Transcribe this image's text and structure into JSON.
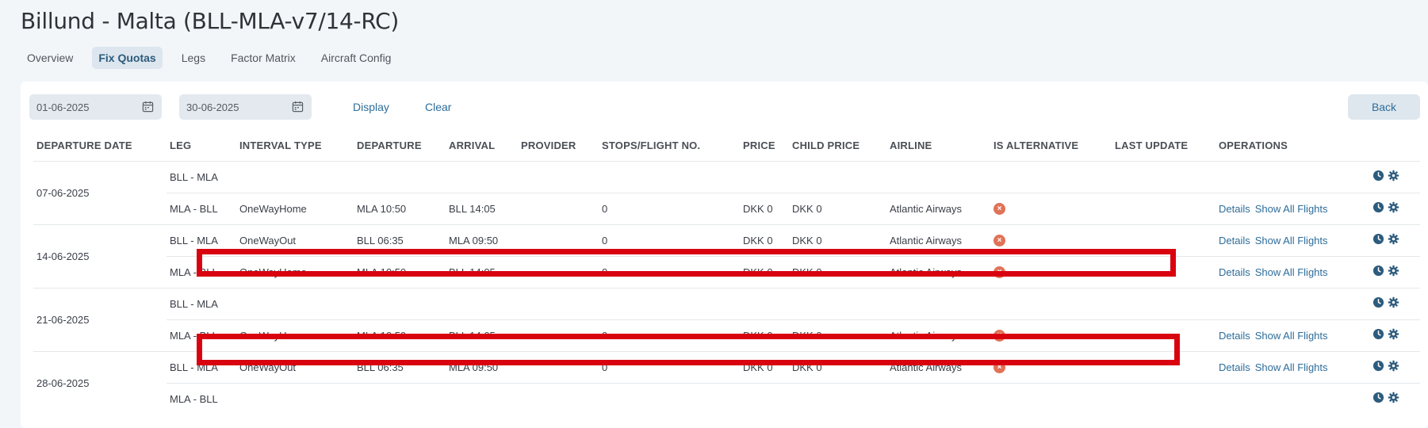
{
  "page": {
    "title": "Billund - Malta (BLL-MLA-v7/14-RC)"
  },
  "tabs": [
    {
      "label": "Overview",
      "active": false
    },
    {
      "label": "Fix Quotas",
      "active": true
    },
    {
      "label": "Legs",
      "active": false
    },
    {
      "label": "Factor Matrix",
      "active": false
    },
    {
      "label": "Aircraft Config",
      "active": false
    }
  ],
  "filters": {
    "date_from": "01-06-2025",
    "date_to": "30-06-2025",
    "display_label": "Display",
    "clear_label": "Clear",
    "back_label": "Back"
  },
  "table": {
    "columns": [
      "DEPARTURE DATE",
      "LEG",
      "INTERVAL TYPE",
      "DEPARTURE",
      "ARRIVAL",
      "PROVIDER",
      "STOPS/FLIGHT NO.",
      "PRICE",
      "CHILD PRICE",
      "AIRLINE",
      "IS ALTERNATIVE",
      "LAST UPDATE",
      "OPERATIONS"
    ],
    "groups": [
      {
        "date": "07-06-2025",
        "rows": [
          {
            "leg": "BLL - MLA",
            "interval": "",
            "departure": "",
            "arrival": "",
            "provider": "",
            "stops": "",
            "price": "",
            "child_price": "",
            "airline": "",
            "is_alternative": false,
            "last_update": "",
            "details": "",
            "show_all": ""
          },
          {
            "leg": "MLA - BLL",
            "interval": "OneWayHome",
            "departure": "MLA 10:50",
            "arrival": "BLL 14:05",
            "provider": "",
            "stops": "0",
            "price": "DKK 0",
            "child_price": "DKK 0",
            "airline": "Atlantic Airways",
            "is_alternative": true,
            "last_update": "",
            "details": "Details",
            "show_all": "Show All Flights"
          }
        ]
      },
      {
        "date": "14-06-2025",
        "rows": [
          {
            "leg": "BLL - MLA",
            "interval": "OneWayOut",
            "departure": "BLL 06:35",
            "arrival": "MLA 09:50",
            "provider": "",
            "stops": "0",
            "price": "DKK 0",
            "child_price": "DKK 0",
            "airline": "Atlantic Airways",
            "is_alternative": true,
            "last_update": "",
            "details": "Details",
            "show_all": "Show All Flights"
          },
          {
            "leg": "MLA - BLL",
            "interval": "OneWayHome",
            "departure": "MLA 10:50",
            "arrival": "BLL 14:05",
            "provider": "",
            "stops": "0",
            "price": "DKK 0",
            "child_price": "DKK 0",
            "airline": "Atlantic Airways",
            "is_alternative": true,
            "last_update": "",
            "details": "Details",
            "show_all": "Show All Flights"
          }
        ]
      },
      {
        "date": "21-06-2025",
        "rows": [
          {
            "leg": "BLL - MLA",
            "interval": "",
            "departure": "",
            "arrival": "",
            "provider": "",
            "stops": "",
            "price": "",
            "child_price": "",
            "airline": "",
            "is_alternative": false,
            "last_update": "",
            "details": "",
            "show_all": "",
            "redacted": true
          },
          {
            "leg": "MLA - BLL",
            "interval": "OneWayHome",
            "departure": "MLA 10:50",
            "arrival": "BLL 14:05",
            "provider": "",
            "stops": "0",
            "price": "DKK 0",
            "child_price": "DKK 0",
            "airline": "Atlantic Airways",
            "is_alternative": true,
            "last_update": "",
            "details": "Details",
            "show_all": "Show All Flights"
          }
        ]
      },
      {
        "date": "28-06-2025",
        "rows": [
          {
            "leg": "BLL - MLA",
            "interval": "OneWayOut",
            "departure": "BLL 06:35",
            "arrival": "MLA 09:50",
            "provider": "",
            "stops": "0",
            "price": "DKK 0",
            "child_price": "DKK 0",
            "airline": "Atlantic Airways",
            "is_alternative": true,
            "last_update": "",
            "details": "Details",
            "show_all": "Show All Flights"
          },
          {
            "leg": "MLA - BLL",
            "interval": "",
            "departure": "",
            "arrival": "",
            "provider": "",
            "stops": "",
            "price": "",
            "child_price": "",
            "airline": "",
            "is_alternative": false,
            "last_update": "",
            "details": "",
            "show_all": "",
            "redacted": true
          }
        ]
      }
    ]
  },
  "icons": {
    "calendar": "calendar-icon",
    "alternative": "x-circle-icon",
    "history": "clock-icon",
    "settings": "gear-icon"
  },
  "colors": {
    "accent": "#2e6d9a",
    "active_tab_bg": "#dde6ee",
    "alternative_icon": "#e07357",
    "operation_icon": "#2c5b7d",
    "redaction": "#d9030f"
  }
}
